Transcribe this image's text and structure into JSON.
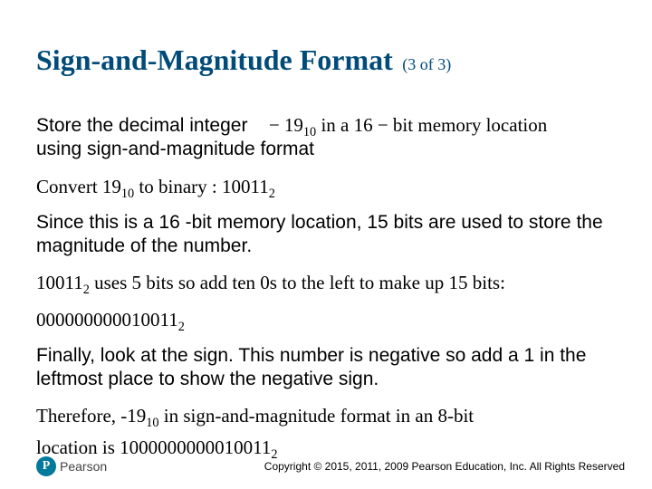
{
  "title": {
    "main": "Sign-and-Magnitude Format",
    "sub": "(3 of 3)"
  },
  "body": {
    "intro_prefix": "Store the decimal integer",
    "intro_math_neg": "− 19",
    "intro_math_base1": "10",
    "intro_math_mid": " in a 16 − bit memory location",
    "intro_suffix": "using sign-and-magnitude format",
    "convert_prefix": "Convert 19",
    "convert_base1": "10",
    "convert_mid": " to binary :  10011",
    "convert_base2": "2",
    "para_mem": "Since this is a 16 -bit memory location, 15 bits are used to store the magnitude of the number.",
    "fivebits_num": "10011",
    "fivebits_base": "2",
    "fivebits_rest": " uses 5 bits so add ten 0s to the left to make up 15 bits:",
    "padded_num": "000000000010011",
    "padded_base": "2",
    "para_sign": "Finally, look at the sign. This number is negative so add a 1 in the leftmost place to show the negative sign.",
    "therefore_prefix": "Therefore, -19",
    "therefore_base1": "10",
    "therefore_mid": " in sign-and-magnitude format in an 8-bit",
    "location_prefix": "location is ",
    "location_num": "1000000000010011",
    "location_base": "2"
  },
  "footer": {
    "logo_letter": "P",
    "logo_text": "Pearson",
    "copyright": "Copyright © 2015, 2011, 2009 Pearson Education, Inc. All Rights Reserved"
  }
}
